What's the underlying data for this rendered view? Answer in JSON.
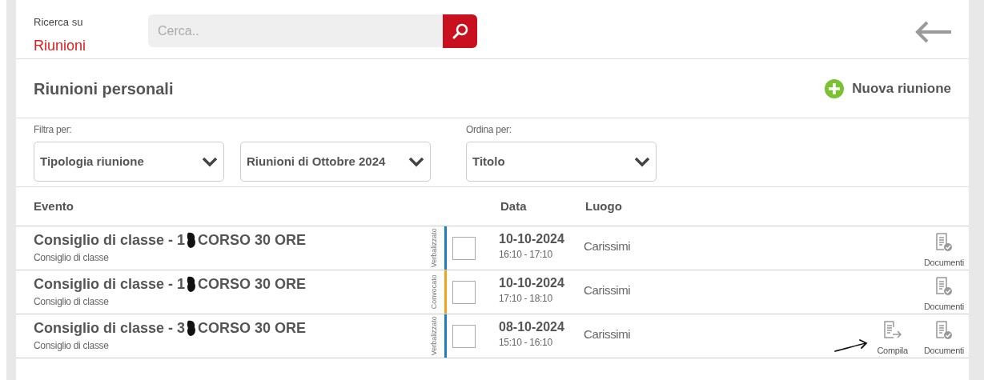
{
  "search": {
    "label": "Ricerca su",
    "scope": "Riunioni",
    "placeholder": "Cerca.."
  },
  "header": {
    "title": "Riunioni personali",
    "new_button": "Nuova riunione"
  },
  "filters": {
    "filter": {
      "label": "Filtra per:",
      "selects": [
        "Tipologia riunione",
        "Riunioni di Ottobre 2024"
      ]
    },
    "sort": {
      "label": "Ordina per:",
      "selects": [
        "Titolo"
      ]
    }
  },
  "table": {
    "columns": [
      "Evento",
      "Data",
      "Luogo"
    ],
    "rows": [
      {
        "title_start": "Consiglio di classe - 1",
        "title_end": "CORSO 30 ORE",
        "subtitle": "Consiglio di classe",
        "status": "Verbalizzato",
        "color": "#1a7fc1",
        "checked": false,
        "date": "10-10-2024",
        "time": "16:10 - 17:10",
        "place": "Carissimi",
        "actions": [
          {
            "kind": "documenti",
            "label": "Documenti"
          }
        ]
      },
      {
        "title_start": "Consiglio di classe - 1",
        "title_end": "CORSO 30 ORE",
        "subtitle": "Consiglio di classe",
        "status": "Convocato",
        "color": "#f5a21b",
        "checked": false,
        "date": "10-10-2024",
        "time": "17:10 - 18:10",
        "place": "Carissimi",
        "actions": [
          {
            "kind": "documenti",
            "label": "Documenti"
          }
        ]
      },
      {
        "title_start": "Consiglio di classe - 3",
        "title_end": "CORSO 30 ORE",
        "subtitle": "Consiglio di classe",
        "status": "Verbalizzato",
        "color": "#1a7fc1",
        "checked": false,
        "date": "08-10-2024",
        "time": "15:10 - 16:10",
        "place": "Carissimi",
        "actions": [
          {
            "kind": "compila",
            "label": "Compila"
          },
          {
            "kind": "documenti",
            "label": "Documenti"
          }
        ]
      }
    ]
  }
}
